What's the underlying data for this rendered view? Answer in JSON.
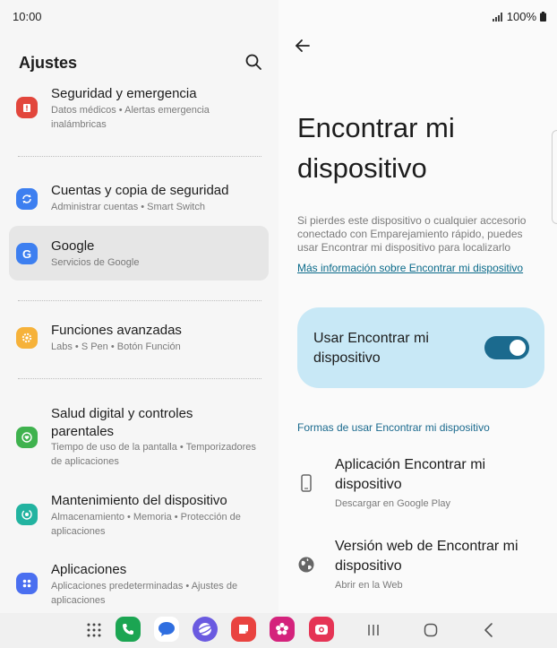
{
  "status": {
    "time": "10:00",
    "battery": "100%"
  },
  "left": {
    "title": "Ajustes",
    "items": [
      {
        "title": "Seguridad y emergencia",
        "subtitle": "Datos médicos • Alertas emergencia inalámbricas",
        "color": "#e2463c"
      },
      {
        "title": "Cuentas y copia de seguridad",
        "subtitle": "Administrar cuentas • Smart Switch",
        "color": "#3d7ff0"
      },
      {
        "title": "Google",
        "subtitle": "Servicios de Google",
        "color": "#3d7ff0"
      },
      {
        "title": "Funciones avanzadas",
        "subtitle": "Labs • S Pen • Botón Función",
        "color": "#f6b23a"
      },
      {
        "title": "Salud digital y controles parentales",
        "subtitle": "Tiempo de uso de la pantalla • Temporizadores de aplicaciones",
        "color": "#3fb24e"
      },
      {
        "title": "Mantenimiento del dispositivo",
        "subtitle": "Almacenamiento • Memoria • Protección de aplicaciones",
        "color": "#22b3a0"
      },
      {
        "title": "Aplicaciones",
        "subtitle": "Aplicaciones predeterminadas • Ajustes de aplicaciones",
        "color": "#4a6ff0"
      }
    ]
  },
  "right": {
    "title": "Encontrar mi dispositivo",
    "description": "Si pierdes este dispositivo o cualquier accesorio conectado con Emparejamiento rápido, puedes usar Encontrar mi dispositivo para localizarlo",
    "link": "Más información sobre Encontrar mi dispositivo",
    "toggle": {
      "label": "Usar Encontrar mi dispositivo",
      "on": true
    },
    "section": "Formas de usar Encontrar mi dispositivo",
    "options": [
      {
        "title": "Aplicación Encontrar mi dispositivo",
        "subtitle": "Descargar en Google Play",
        "icon": "phone-icon"
      },
      {
        "title": "Versión web de Encontrar mi dispositivo",
        "subtitle": "Abrir en la Web",
        "icon": "globe-icon"
      }
    ]
  },
  "accent": "#1b6a8e"
}
